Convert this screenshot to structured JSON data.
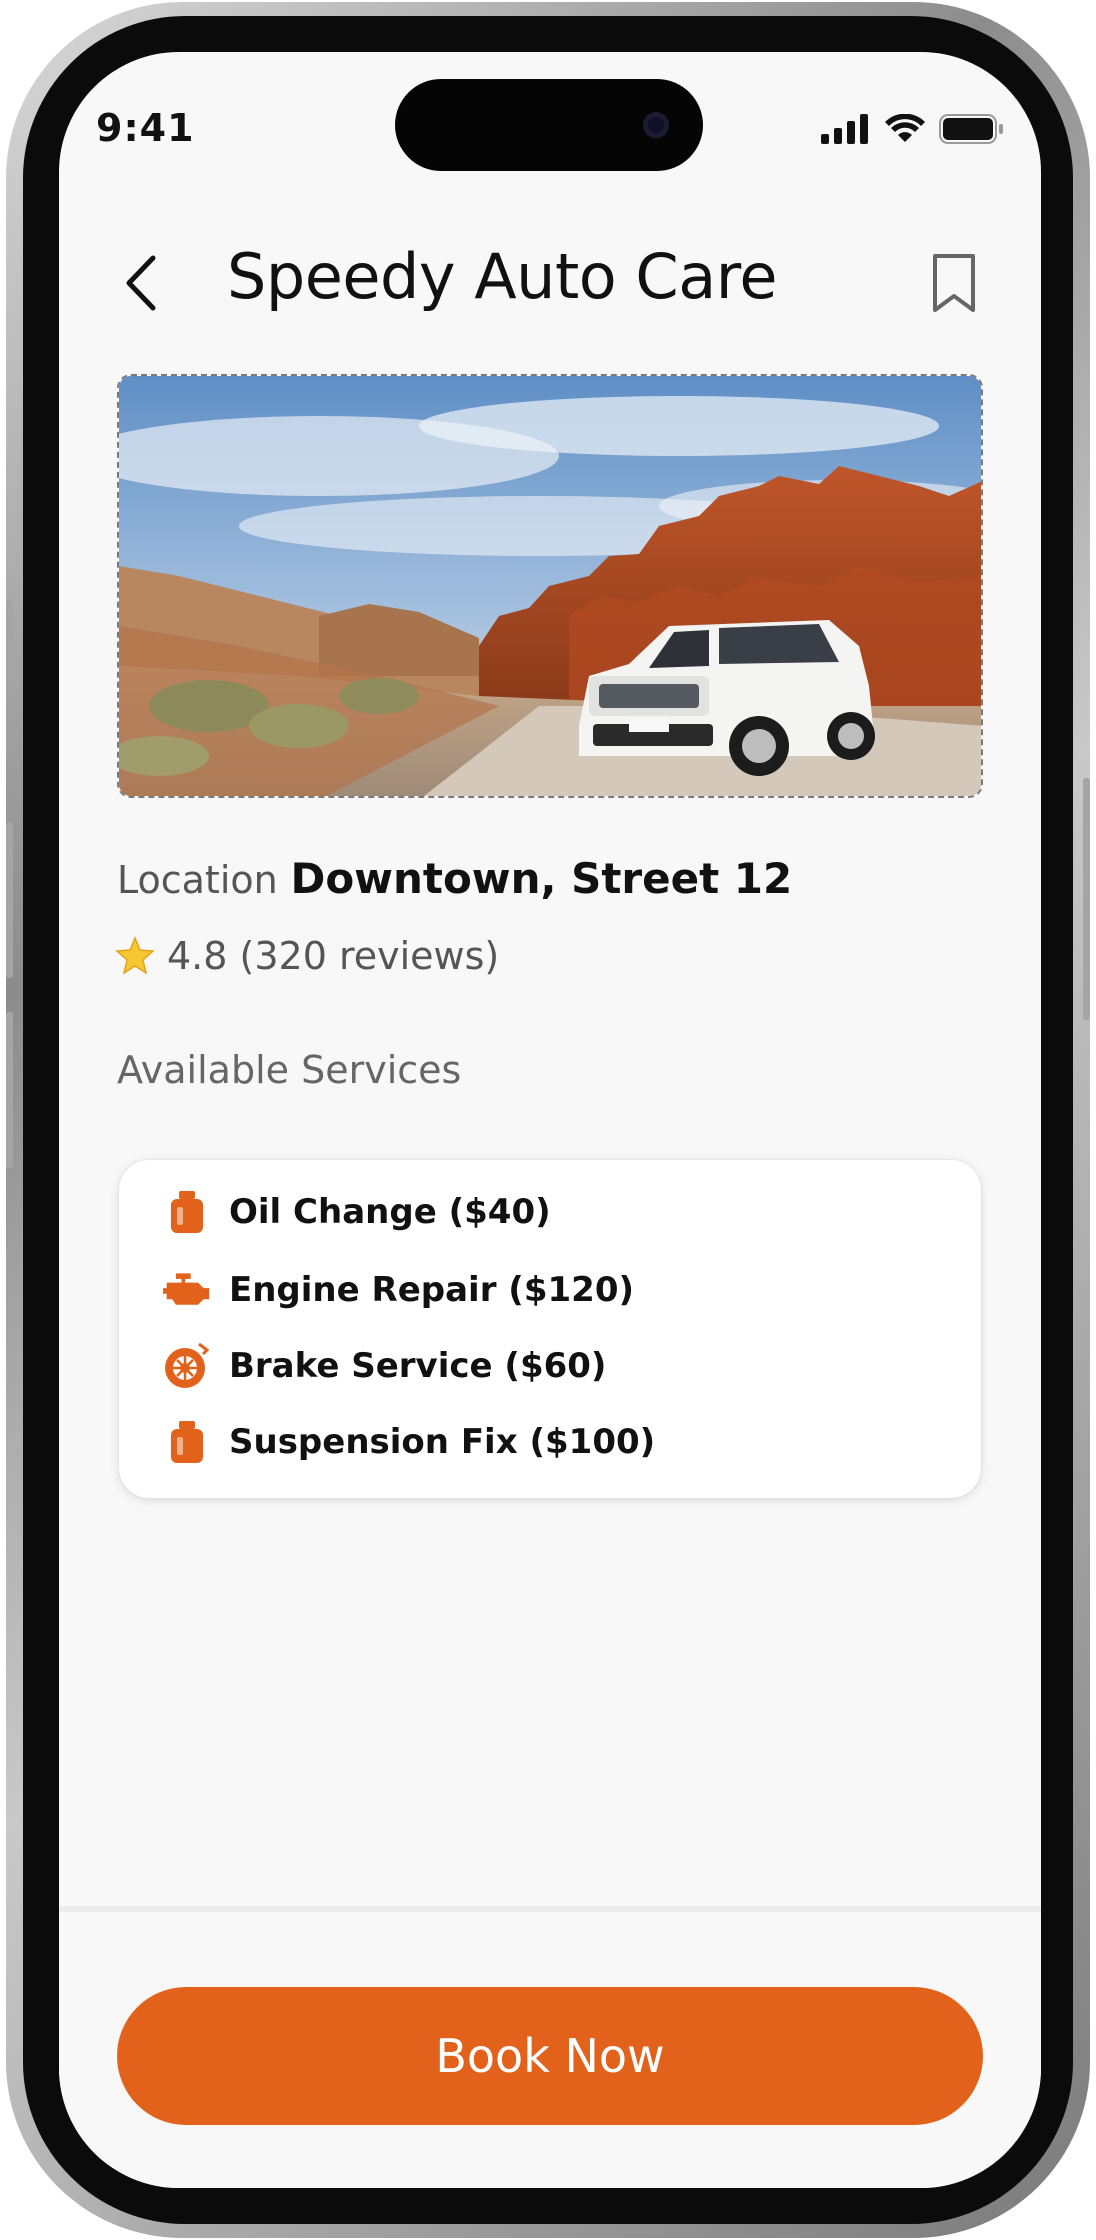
{
  "status_bar": {
    "time": "9:41"
  },
  "header": {
    "title": "Speedy Auto Care",
    "back_icon": "chevron-left-icon",
    "bookmark_icon": "bookmark-icon"
  },
  "shop": {
    "location_label": "Location",
    "location_value": "Downtown, Street 12",
    "rating_text": "4.8 (320 reviews)"
  },
  "services": {
    "title": "Available Services",
    "items": [
      {
        "label": "Oil Change ($40)",
        "icon": "oil-can-icon"
      },
      {
        "label": "Engine Repair ($120)",
        "icon": "engine-icon"
      },
      {
        "label": "Brake Service ($60)",
        "icon": "brake-disc-icon"
      },
      {
        "label": "Suspension Fix ($100)",
        "icon": "oil-can-icon"
      }
    ]
  },
  "actions": {
    "book_label": "Book Now"
  },
  "colors": {
    "accent": "#e2621b",
    "background": "#f8f8f8",
    "card": "#ffffff"
  }
}
